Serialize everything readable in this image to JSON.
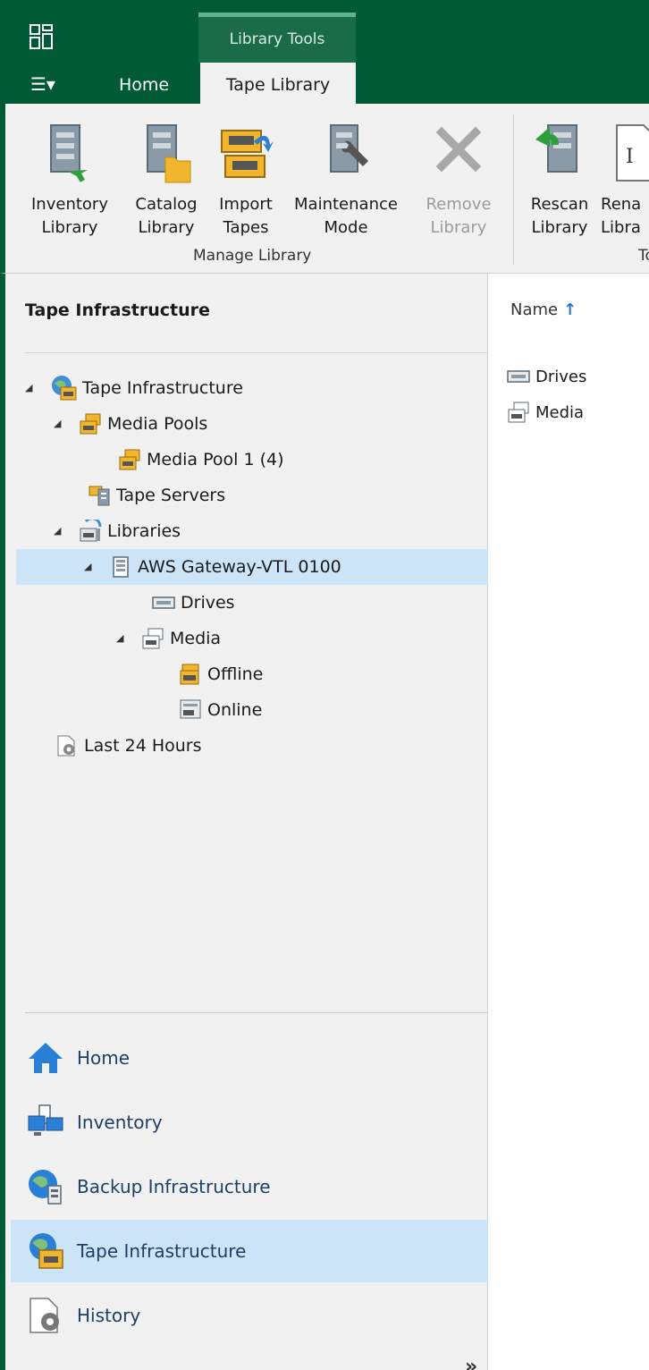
{
  "tabs": {
    "context_tab": "Library Tools",
    "home": "Home",
    "tape_library": "Tape Library"
  },
  "ribbon": {
    "buttons": [
      {
        "line1": "Inventory",
        "line2": "Library",
        "icon": "inventory-library-icon"
      },
      {
        "line1": "Catalog",
        "line2": "Library",
        "icon": "catalog-library-icon"
      },
      {
        "line1": "Import",
        "line2": "Tapes",
        "icon": "import-tapes-icon"
      },
      {
        "line1": "Maintenance",
        "line2": "Mode",
        "icon": "maintenance-mode-icon"
      },
      {
        "line1": "Remove",
        "line2": "Library",
        "icon": "remove-icon",
        "disabled": true
      },
      {
        "line1": "Rescan",
        "line2": "Library",
        "icon": "rescan-library-icon"
      },
      {
        "line1": "Rena",
        "line2": "Libra",
        "icon": "rename-library-icon"
      }
    ],
    "group_manage": "Manage Library",
    "group_tools_partial": "To"
  },
  "left_panel": {
    "title": "Tape Infrastructure",
    "tree": [
      {
        "label": "Tape Infrastructure"
      },
      {
        "label": "Media Pools"
      },
      {
        "label": "Media Pool 1 (4)"
      },
      {
        "label": "Tape Servers"
      },
      {
        "label": "Libraries"
      },
      {
        "label": "AWS Gateway-VTL 0100"
      },
      {
        "label": "Drives"
      },
      {
        "label": "Media"
      },
      {
        "label": "Offline"
      },
      {
        "label": "Online"
      },
      {
        "label": "Last 24 Hours"
      }
    ],
    "nav": [
      {
        "label": "Home"
      },
      {
        "label": "Inventory"
      },
      {
        "label": "Backup Infrastructure"
      },
      {
        "label": "Tape Infrastructure"
      },
      {
        "label": "History"
      }
    ],
    "more": "»"
  },
  "content": {
    "column_name": "Name",
    "sort_arrow": "↑",
    "rows": [
      {
        "label": "Drives"
      },
      {
        "label": "Media"
      }
    ]
  },
  "colors": {
    "brand_green": "#005a36",
    "selection": "#cce4f7",
    "link_blue": "#1e3f66"
  }
}
